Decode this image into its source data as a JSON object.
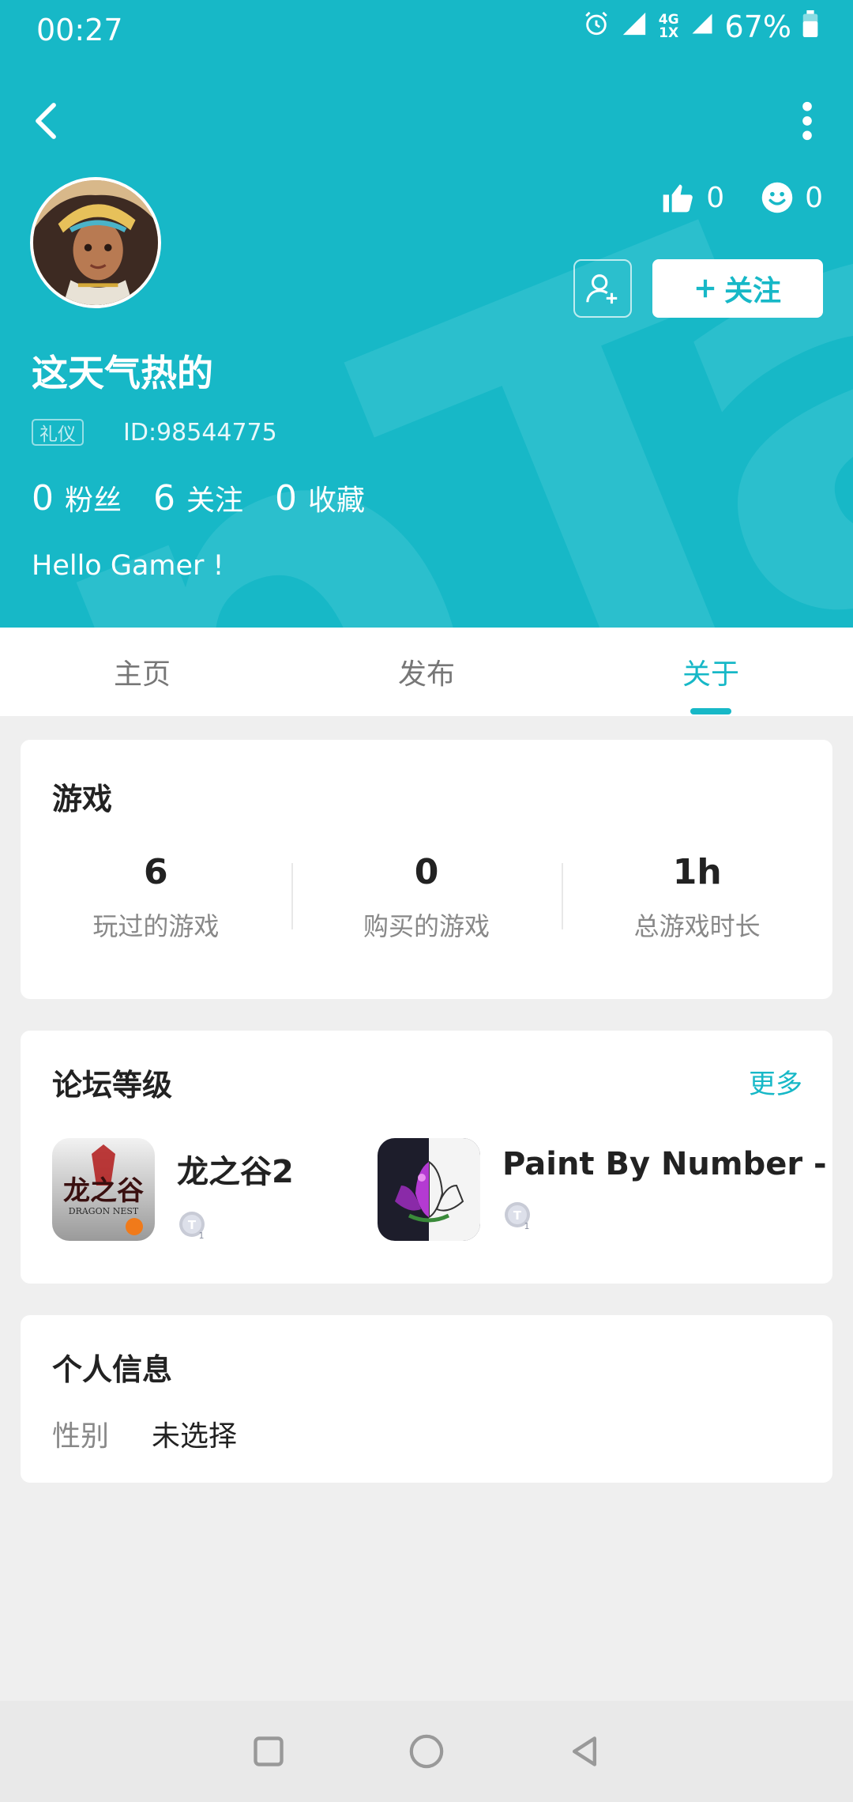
{
  "status_bar": {
    "time": "00:27",
    "network_top": "4G",
    "network_bottom": "1X",
    "battery": "67%"
  },
  "profile": {
    "username": "这天气热的",
    "badge": "礼仪",
    "user_id": "ID:98544775",
    "bio": "Hello Gamer !",
    "likes": "0",
    "smiles": "0",
    "follow_label": "关注",
    "stats": [
      {
        "num": "0",
        "label": "粉丝"
      },
      {
        "num": "6",
        "label": "关注"
      },
      {
        "num": "0",
        "label": "收藏"
      }
    ]
  },
  "tabs": [
    {
      "label": "主页",
      "active": false
    },
    {
      "label": "发布",
      "active": false
    },
    {
      "label": "关于",
      "active": true
    }
  ],
  "games": {
    "title": "游戏",
    "stats": [
      {
        "value": "6",
        "label": "玩过的游戏"
      },
      {
        "value": "0",
        "label": "购买的游戏"
      },
      {
        "value": "1h",
        "label": "总游戏时长"
      }
    ]
  },
  "forum": {
    "title": "论坛等级",
    "more": "更多",
    "items": [
      {
        "name": "龙之谷2",
        "icon_text": "龙之谷",
        "icon_sub": "DRAGON NEST",
        "level": "1"
      },
      {
        "name": "Paint By Number - Free",
        "level": "1"
      }
    ]
  },
  "personal": {
    "title": "个人信息",
    "fields": [
      {
        "key": "性别",
        "value": "未选择"
      }
    ]
  },
  "colors": {
    "accent": "#17b8c7",
    "background": "#efefef"
  }
}
